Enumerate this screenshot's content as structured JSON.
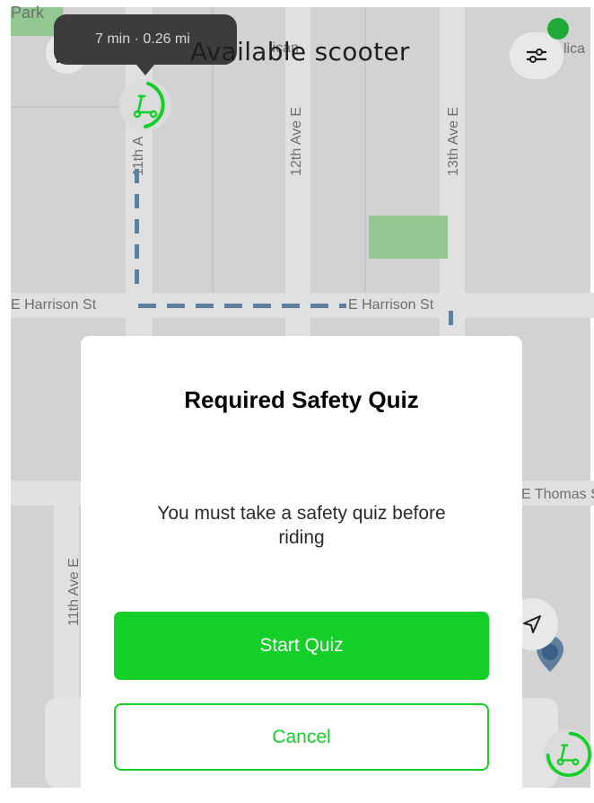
{
  "map": {
    "labels": {
      "park": "Park",
      "street_11th_top": "11th A",
      "street_12th": "12th Ave E",
      "street_13th": "13th Ave E",
      "harrison_left": "E Harrison St",
      "harrison_right": "E Harrison St",
      "thomas": "E Thomas S",
      "street_11th_bottom": "11th Ave E",
      "top_right_fragment": "lica",
      "top_center_fragment": "lican"
    }
  },
  "header": {
    "title": "Available scooter",
    "tooltip": "7 min · 0.26 mi"
  },
  "icons": {
    "profile": "person-icon",
    "filters": "sliders-icon",
    "locate": "navigation-arrow-icon",
    "scooter": "scooter-icon"
  },
  "modal": {
    "title": "Required Safety Quiz",
    "message": "You must take a safety quiz before riding",
    "primary_label": "Start Quiz",
    "secondary_label": "Cancel"
  },
  "colors": {
    "accent_green": "#14cf27",
    "status_dot": "#22a93a",
    "route_blue": "#5f7f9c"
  }
}
